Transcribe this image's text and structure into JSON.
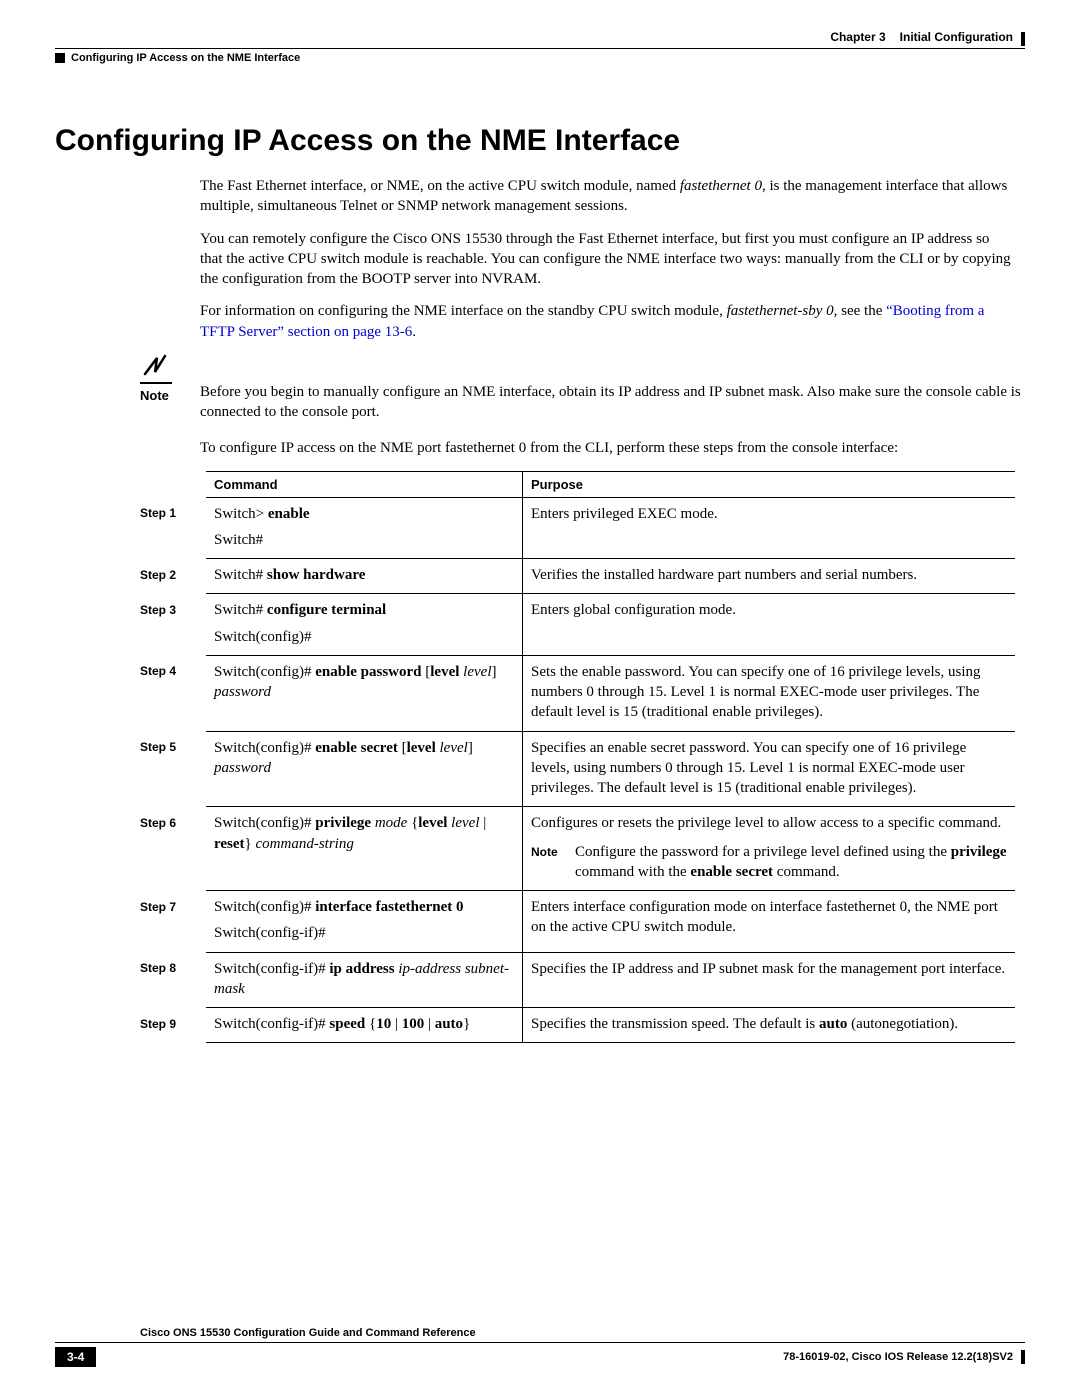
{
  "header": {
    "chapter": "Chapter 3",
    "chapter_title": "Initial Configuration",
    "section": "Configuring IP Access on the NME Interface"
  },
  "title": "Configuring IP Access on the NME Interface",
  "paragraphs": {
    "p1a": "The Fast Ethernet interface, or NME, on the active CPU switch module, named ",
    "p1b": "fastethernet 0",
    "p1c": ", is the management interface that allows multiple, simultaneous Telnet or SNMP network management sessions.",
    "p2": "You can remotely configure the Cisco ONS 15530 through the Fast Ethernet interface, but first you must configure an IP address so that the active CPU switch module is reachable. You can configure the NME interface two ways: manually from the CLI or by copying the configuration from the BOOTP server into NVRAM.",
    "p3a": "For information on configuring the NME interface on the standby CPU switch module, ",
    "p3b": "fastethernet-sby 0",
    "p3c": ", see the ",
    "p3link": "“Booting from a TFTP Server” section on page 13-6",
    "p3d": ".",
    "p4": "To configure IP access on the NME port fastethernet 0 from the CLI, perform these steps from the console interface:"
  },
  "note": {
    "label": "Note",
    "text": "Before you begin to manually configure an NME interface, obtain its IP address and IP subnet mask. Also make sure the console cable is connected to the console port."
  },
  "table": {
    "headers": {
      "command": "Command",
      "purpose": "Purpose"
    },
    "rows": [
      {
        "step": "Step 1",
        "cmd_parts": [
          "Switch> ",
          "enable"
        ],
        "cmd_line2": "Switch#",
        "purpose": "Enters privileged EXEC mode."
      },
      {
        "step": "Step 2",
        "cmd_parts": [
          "Switch# ",
          "show hardware"
        ],
        "purpose": "Verifies the installed hardware part numbers and serial numbers."
      },
      {
        "step": "Step 3",
        "cmd_parts": [
          "Switch# ",
          "configure terminal"
        ],
        "cmd_line2": "Switch(config)#",
        "purpose": "Enters global configuration mode."
      },
      {
        "step": "Step 4",
        "cmd_html": "Switch(config)# <b>enable password</b>  [<b>level</b> <i>level</i>] <i>password</i>",
        "purpose": "Sets the enable password. You can specify one of 16 privilege levels, using numbers 0 through 15. Level 1 is normal EXEC-mode user privileges. The default level is 15 (traditional enable privileges)."
      },
      {
        "step": "Step 5",
        "cmd_html": "Switch(config)# <b>enable secret</b>  [<b>level</b> <i>level</i>] <i>password</i>",
        "purpose": "Specifies an enable secret password. You can specify one of 16 privilege levels, using numbers 0 through 15. Level 1 is normal EXEC-mode user privileges. The default level is 15 (traditional enable privileges)."
      },
      {
        "step": "Step 6",
        "cmd_html": "Switch(config)# <b>privilege</b> <i>mode</i> {<b>level</b> <i>level</i> | <b>reset</b>} <i>command-string</i>",
        "purpose": "Configures or resets the privilege level to allow access to a specific command.",
        "note_label": "Note",
        "note_html": "Configure the password for a privilege level defined using the <b>privilege</b> command with the <b>enable secret</b> command."
      },
      {
        "step": "Step 7",
        "cmd_html": "Switch(config)# <b>interface</b>  <b>fastethernet 0</b>",
        "cmd_line2": "Switch(config-if)#",
        "purpose": "Enters interface configuration mode on interface fastethernet 0, the NME port on the active CPU switch module."
      },
      {
        "step": "Step 8",
        "cmd_html": "Switch(config-if)# <b>ip address</b>  <i>ip-address subnet-mask</i>",
        "purpose": "Specifies the IP address and IP subnet mask for the management port interface."
      },
      {
        "step": "Step 9",
        "cmd_html": "Switch(config-if)# <b>speed</b> {<b>10</b> | <b>100</b> | <b>auto</b>}",
        "purpose_html": "Specifies the transmission speed. The default is <b>auto</b> (autonegotiation)."
      }
    ]
  },
  "footer": {
    "doc_title": "Cisco ONS 15530 Configuration Guide and Command Reference",
    "page": "3-4",
    "release": "78-16019-02, Cisco IOS Release 12.2(18)SV2"
  }
}
